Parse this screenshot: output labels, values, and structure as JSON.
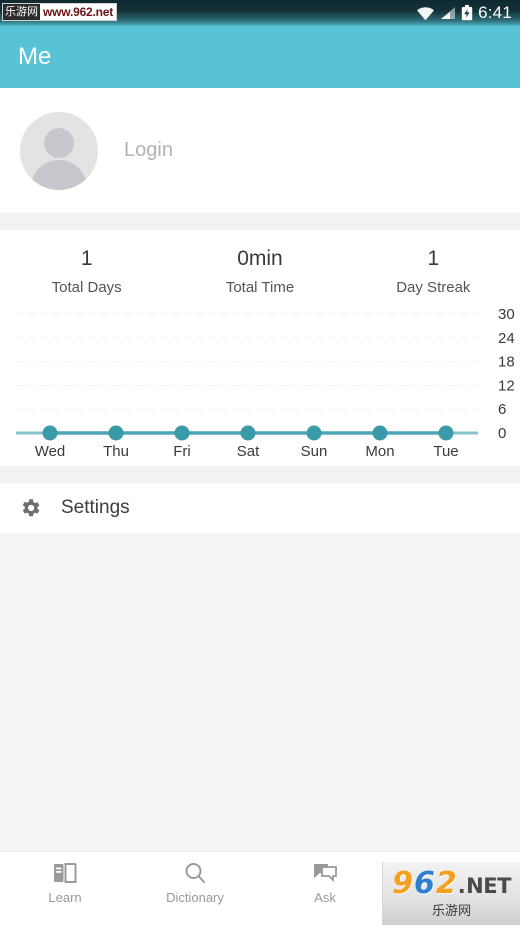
{
  "statusbar": {
    "clock": "6:41",
    "icons": [
      "wifi-icon",
      "signal-icon",
      "battery-charging-icon"
    ]
  },
  "watermark_url": {
    "badge_cn": "乐游网",
    "url": "www.962.net"
  },
  "watermark_logo": {
    "d9": "9",
    "d6": "6",
    "d2": "2",
    "dot": ".",
    "net": "NET",
    "cn": "乐游网"
  },
  "appbar": {
    "title": "Me",
    "color": "#57c3d4"
  },
  "profile": {
    "login_label": "Login",
    "avatar_icon": "default-avatar-icon"
  },
  "stats": [
    {
      "value": "1",
      "label": "Total Days"
    },
    {
      "value": "0min",
      "label": "Total Time"
    },
    {
      "value": "1",
      "label": "Day Streak"
    }
  ],
  "settings": {
    "label": "Settings",
    "icon": "gear-icon"
  },
  "bottomnav": [
    {
      "label": "Learn",
      "icon": "book-icon"
    },
    {
      "label": "Dictionary",
      "icon": "search-icon"
    },
    {
      "label": "Ask",
      "icon": "chat-icon"
    }
  ],
  "chart_data": {
    "type": "line",
    "title": "",
    "xlabel": "",
    "ylabel": "",
    "categories": [
      "Wed",
      "Thu",
      "Fri",
      "Sat",
      "Sun",
      "Mon",
      "Tue"
    ],
    "values": [
      0,
      0,
      0,
      0,
      0,
      0,
      0
    ],
    "yticks": [
      0,
      6,
      12,
      18,
      24,
      30
    ],
    "ylim": [
      0,
      30
    ],
    "grid": true,
    "legend": "none",
    "line_color": "#4aa6b5",
    "point_color": "#3b9aa8",
    "gridline_color": "#f0f0f0"
  }
}
